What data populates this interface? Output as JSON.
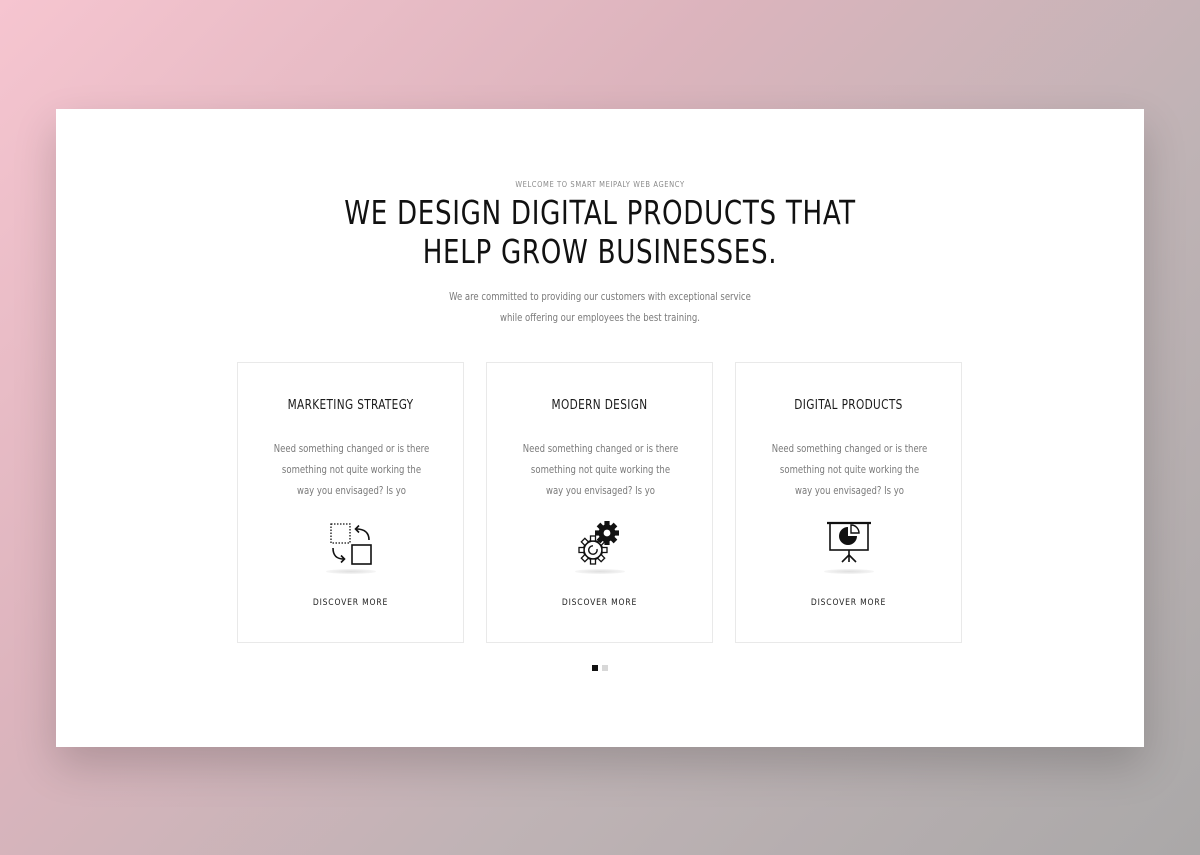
{
  "hero": {
    "eyebrow": "WELCOME TO SMART MEIPALY WEB AGENCY",
    "headline_line1": "WE DESIGN DIGITAL PRODUCTS THAT",
    "headline_line2": "HELP GROW BUSINESSES.",
    "intro_line1": "We are committed to providing our customers with exceptional service",
    "intro_line2": "while offering our employees the best training."
  },
  "cards": [
    {
      "title": "MARKETING STRATEGY",
      "text_line1": "Need something changed or is there",
      "text_line2": "something not quite working the",
      "text_line3": "way you envisaged? Is yo",
      "icon": "arrange-icon",
      "link": "DISCOVER MORE"
    },
    {
      "title": "MODERN DESIGN",
      "text_line1": "Need something changed or is there",
      "text_line2": "something not quite working the",
      "text_line3": "way you envisaged? Is yo",
      "icon": "gears-icon",
      "link": "DISCOVER MORE"
    },
    {
      "title": "DIGITAL PRODUCTS",
      "text_line1": "Need something changed or is there",
      "text_line2": "something not quite working the",
      "text_line3": "way you envisaged? Is yo",
      "icon": "presentation-chart-icon",
      "link": "DISCOVER MORE"
    }
  ],
  "carousel": {
    "page_count": 2,
    "active_page": 1
  }
}
